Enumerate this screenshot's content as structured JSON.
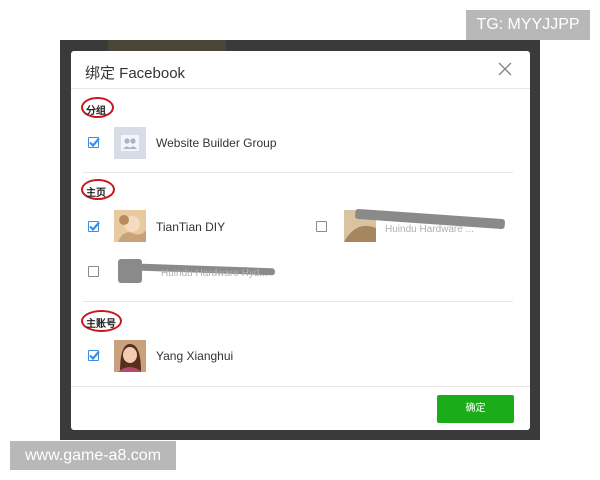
{
  "overlay": {
    "tg_watermark": "TG: MYYJJPP",
    "site_watermark": "www.game-a8.com"
  },
  "dialog": {
    "title": "绑定 Facebook",
    "confirm_label": "确定",
    "sections": [
      {
        "label": "分组"
      },
      {
        "label": "主页"
      },
      {
        "label": "主账号"
      }
    ],
    "group_items": [
      {
        "name": "Website Builder Group",
        "checked": true,
        "avatar": "group-placeholder-icon"
      }
    ],
    "page_items": [
      {
        "name": "TianTian DIY",
        "checked": true,
        "avatar": "photo-avatar"
      },
      {
        "name": "Huindu Hardware ...",
        "checked": false,
        "avatar": "photo-avatar",
        "redacted": true
      },
      {
        "name": "Huindu Hardware Hyd...",
        "checked": false,
        "avatar": "gray-avatar",
        "redacted": true
      }
    ],
    "account_items": [
      {
        "name": "Yang Xianghui",
        "checked": true,
        "avatar": "person-photo-avatar"
      }
    ]
  },
  "colors": {
    "accent_green": "#1aad19",
    "checkbox_blue": "#3a8ee6",
    "annotation_red": "#c8161d",
    "backdrop": "#3a3a3a"
  }
}
